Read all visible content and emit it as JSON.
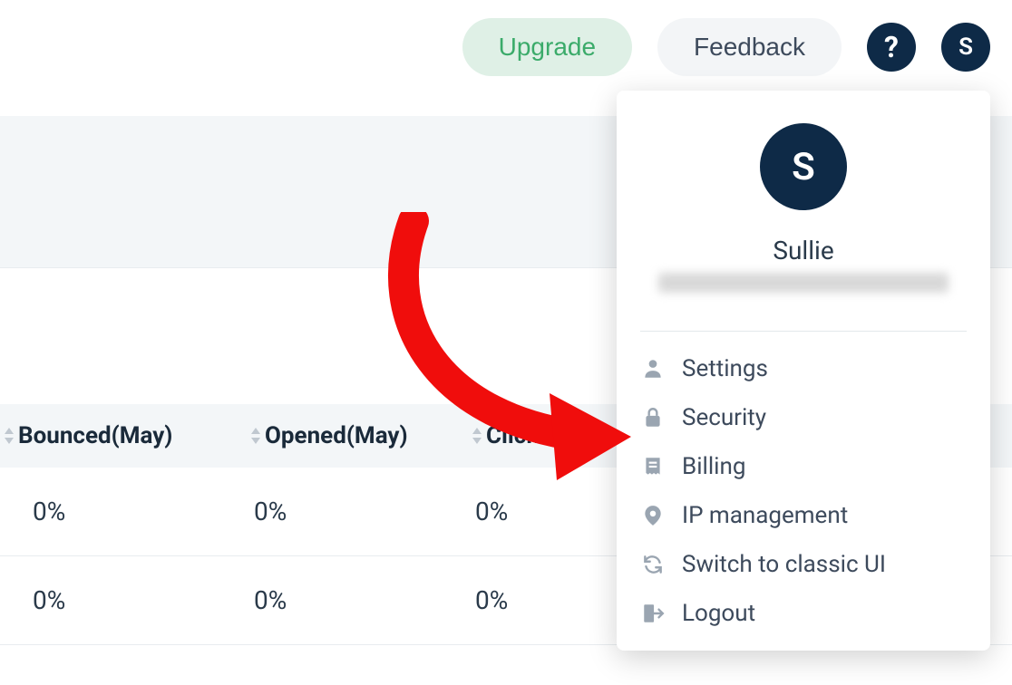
{
  "header": {
    "upgrade_label": "Upgrade",
    "feedback_label": "Feedback",
    "avatar_initial": "S"
  },
  "table": {
    "columns": [
      "Bounced(May)",
      "Opened(May)",
      "Click"
    ],
    "rows": [
      {
        "bounced": "0%",
        "opened": "0%",
        "clicked": "0%"
      },
      {
        "bounced": "0%",
        "opened": "0%",
        "clicked": "0%"
      }
    ]
  },
  "dropdown": {
    "avatar_initial": "S",
    "user_name": "Sullie",
    "menu": {
      "settings": "Settings",
      "security": "Security",
      "billing": "Billing",
      "ip_management": "IP management",
      "switch_ui": "Switch to classic UI",
      "logout": "Logout"
    }
  }
}
